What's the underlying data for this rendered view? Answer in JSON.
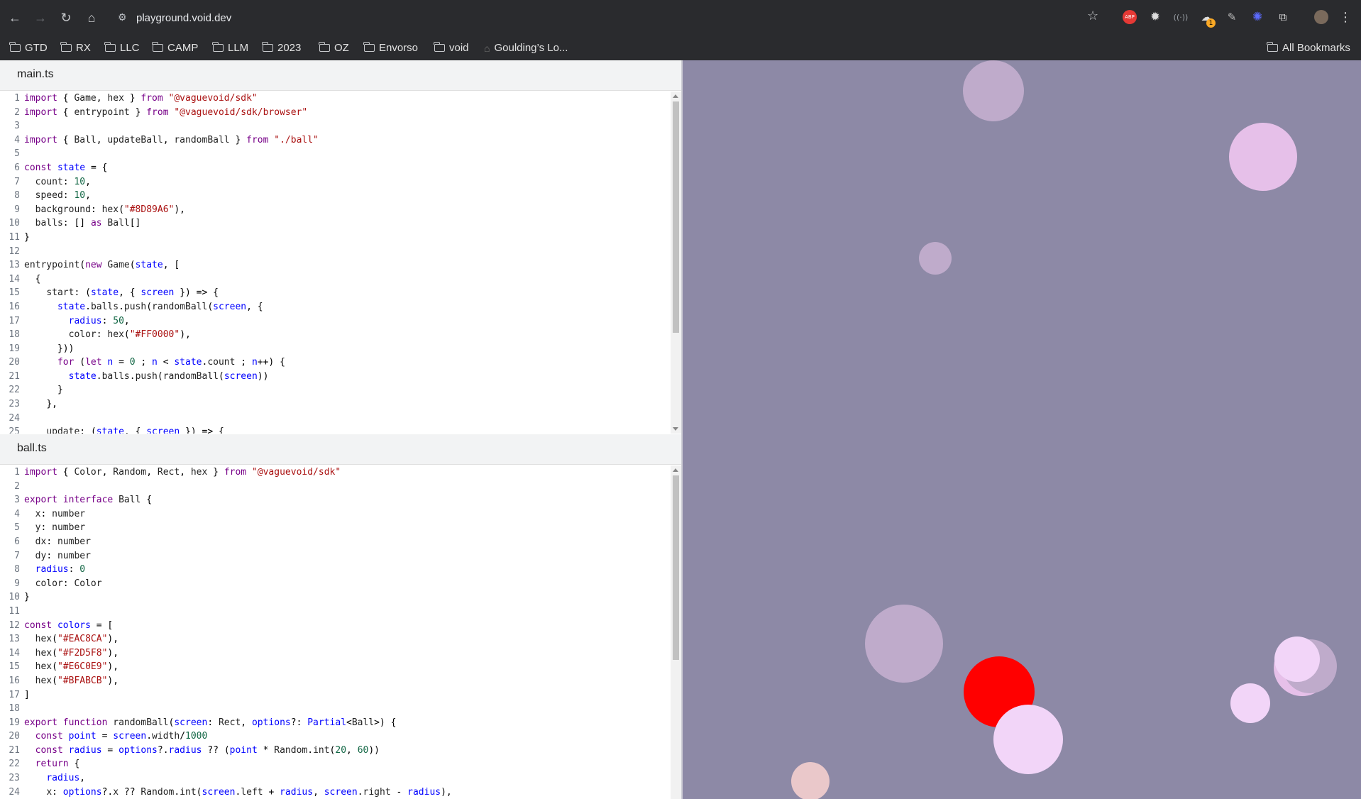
{
  "browser": {
    "url": "playground.void.dev",
    "extension_badge": "ABP",
    "extension_count": "1"
  },
  "bookmarks": [
    "GTD",
    "RX",
    "LLC",
    "CAMP",
    "LLM",
    "2023",
    "OZ",
    "Envorso",
    "void",
    "Goulding’s Lo..."
  ],
  "all_bookmarks": "All Bookmarks",
  "editor": {
    "main_title": "main.ts",
    "ball_title": "ball.ts",
    "main_lines": [
      "import { Game, hex } from \"@vaguevoid/sdk\"",
      "import { entrypoint } from \"@vaguevoid/sdk/browser\"",
      "",
      "import { Ball, updateBall, randomBall } from \"./ball\"",
      "",
      "const state = {",
      "  count: 10,",
      "  speed: 10,",
      "  background: hex(\"#8D89A6\"),",
      "  balls: [] as Ball[]",
      "}",
      "",
      "entrypoint(new Game(state, [",
      "  {",
      "    start: (state, { screen }) => {",
      "      state.balls.push(randomBall(screen, {",
      "        radius: 50,",
      "        color: hex(\"#FF0000\"),",
      "      }))",
      "      for (let n = 0 ; n < state.count ; n++) {",
      "        state.balls.push(randomBall(screen))",
      "      }",
      "    },",
      "",
      "    update: (state, { screen }) => {"
    ],
    "ball_lines": [
      "import { Color, Random, Rect, hex } from \"@vaguevoid/sdk\"",
      "",
      "export interface Ball {",
      "  x: number",
      "  y: number",
      "  dx: number",
      "  dy: number",
      "  radius: 0",
      "  color: Color",
      "}",
      "",
      "const colors = [",
      "  hex(\"#EAC8CA\"),",
      "  hex(\"#F2D5F8\"),",
      "  hex(\"#E6C0E9\"),",
      "  hex(\"#BFABCB\"),",
      "]",
      "",
      "export function randomBall(screen: Rect, options?: Partial<Ball>) {",
      "  const point = screen.width/1000",
      "  const radius = options?.radius ?? (point * Random.int(20, 60))",
      "  return {",
      "    radius,",
      "    x: options?.x ?? Random.int(screen.left + radius, screen.right - radius),"
    ]
  },
  "canvas": {
    "background": "#8D89A6",
    "balls": [
      {
        "color": "#BFABCB"
      },
      {
        "color": "#E6C0E9"
      },
      {
        "color": "#BFABCB"
      },
      {
        "color": "#E6C0E9"
      },
      {
        "color": "#BFABCB"
      },
      {
        "color": "#BFABCB"
      },
      {
        "color": "#F2D5F8"
      },
      {
        "color": "#FF0000"
      },
      {
        "color": "#F2D5F8"
      },
      {
        "color": "#F2D5F8"
      },
      {
        "color": "#EAC8CA"
      }
    ]
  }
}
